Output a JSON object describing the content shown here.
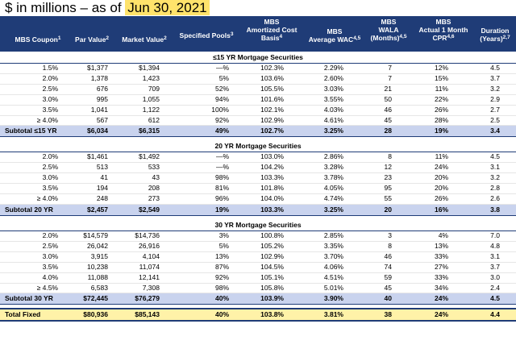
{
  "title": {
    "prefix": "$ in millions – as of ",
    "date": "Jun 30, 2021"
  },
  "headers": {
    "coupon": "MBS Coupon",
    "coupon_sup": "1",
    "par": "Par Value",
    "par_sup": "2",
    "market": "Market Value",
    "market_sup": "2",
    "pools": "Specified Pools",
    "pools_sup": "3",
    "amort_1": "MBS",
    "amort_2": "Amortized Cost",
    "amort_3": "Basis",
    "amort_sup": "4",
    "wac_1": "MBS",
    "wac_2": "Average WAC",
    "wac_sup": "4,5",
    "wala_1": "MBS",
    "wala_2": "WALA",
    "wala_3": "(Months)",
    "wala_sup": "4,5",
    "cpr_1": "MBS",
    "cpr_2": "Actual 1 Month",
    "cpr_3": "CPR",
    "cpr_sup": "4,6",
    "dur_1": "Duration",
    "dur_2": "(Years)",
    "dur_sup": "2,7"
  },
  "sections": [
    {
      "title": "≤15 YR Mortgage Securities",
      "rows": [
        [
          "1.5%",
          "$1,377",
          "$1,394",
          "—%",
          "102.3%",
          "2.29%",
          "7",
          "12%",
          "4.5"
        ],
        [
          "2.0%",
          "1,378",
          "1,423",
          "5%",
          "103.6%",
          "2.60%",
          "7",
          "15%",
          "3.7"
        ],
        [
          "2.5%",
          "676",
          "709",
          "52%",
          "105.5%",
          "3.03%",
          "21",
          "11%",
          "3.2"
        ],
        [
          "3.0%",
          "995",
          "1,055",
          "94%",
          "101.6%",
          "3.55%",
          "50",
          "22%",
          "2.9"
        ],
        [
          "3.5%",
          "1,041",
          "1,122",
          "100%",
          "102.1%",
          "4.03%",
          "46",
          "26%",
          "2.7"
        ],
        [
          "≥ 4.0%",
          "567",
          "612",
          "92%",
          "102.9%",
          "4.61%",
          "45",
          "28%",
          "2.5"
        ]
      ],
      "subtotal": [
        "Subtotal ≤15 YR",
        "$6,034",
        "$6,315",
        "49%",
        "102.7%",
        "3.25%",
        "28",
        "19%",
        "3.4"
      ]
    },
    {
      "title": "20 YR Mortgage Securities",
      "rows": [
        [
          "2.0%",
          "$1,461",
          "$1,492",
          "—%",
          "103.0%",
          "2.86%",
          "8",
          "11%",
          "4.5"
        ],
        [
          "2.5%",
          "513",
          "533",
          "—%",
          "104.2%",
          "3.28%",
          "12",
          "24%",
          "3.1"
        ],
        [
          "3.0%",
          "41",
          "43",
          "98%",
          "103.3%",
          "3.78%",
          "23",
          "20%",
          "3.2"
        ],
        [
          "3.5%",
          "194",
          "208",
          "81%",
          "101.8%",
          "4.05%",
          "95",
          "20%",
          "2.8"
        ],
        [
          "≥ 4.0%",
          "248",
          "273",
          "96%",
          "104.0%",
          "4.74%",
          "55",
          "26%",
          "2.6"
        ]
      ],
      "subtotal": [
        "Subtotal 20 YR",
        "$2,457",
        "$2,549",
        "19%",
        "103.3%",
        "3.25%",
        "20",
        "16%",
        "3.8"
      ]
    },
    {
      "title": "30 YR Mortgage Securities",
      "rows": [
        [
          "2.0%",
          "$14,579",
          "$14,736",
          "3%",
          "100.8%",
          "2.85%",
          "3",
          "4%",
          "7.0"
        ],
        [
          "2.5%",
          "26,042",
          "26,916",
          "5%",
          "105.2%",
          "3.35%",
          "8",
          "13%",
          "4.8"
        ],
        [
          "3.0%",
          "3,915",
          "4,104",
          "13%",
          "102.9%",
          "3.70%",
          "46",
          "33%",
          "3.1"
        ],
        [
          "3.5%",
          "10,238",
          "11,074",
          "87%",
          "104.5%",
          "4.06%",
          "74",
          "27%",
          "3.7"
        ],
        [
          "4.0%",
          "11,088",
          "12,141",
          "92%",
          "105.1%",
          "4.51%",
          "59",
          "33%",
          "3.0"
        ],
        [
          "≥ 4.5%",
          "6,583",
          "7,308",
          "98%",
          "105.8%",
          "5.01%",
          "45",
          "34%",
          "2.4"
        ]
      ],
      "subtotal": [
        "Subtotal 30 YR",
        "$72,445",
        "$76,279",
        "40%",
        "103.9%",
        "3.90%",
        "40",
        "24%",
        "4.5"
      ]
    }
  ],
  "total": [
    "Total Fixed",
    "$80,936",
    "$85,143",
    "40%",
    "103.8%",
    "3.81%",
    "38",
    "24%",
    "4.4"
  ]
}
